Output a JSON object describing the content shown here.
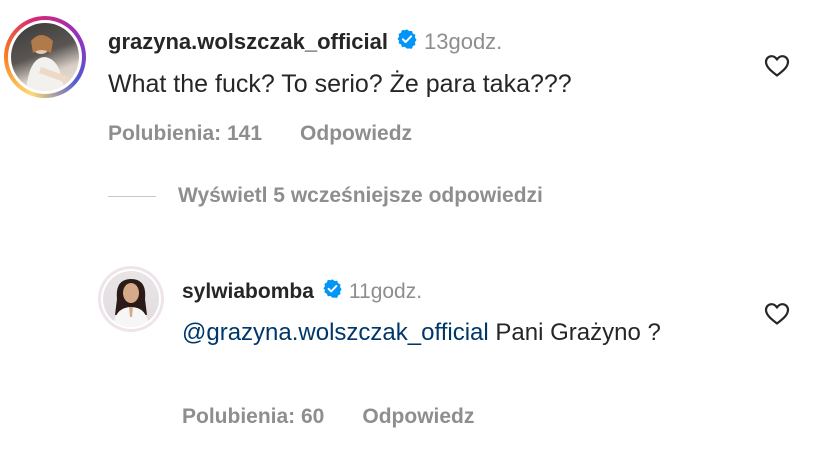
{
  "comments": [
    {
      "username": "grazyna.wolszczak_official",
      "time": "13godz.",
      "text": "What the fuck? To serio? Że para taka???",
      "likes": "Polubienia: 141",
      "reply": "Odpowiedz",
      "avatar_icon": "user-avatar-photo",
      "heart_icon": "heart-outline-icon"
    },
    {
      "username": "sylwiabomba",
      "time": "11godz.",
      "mention": "@grazyna.wolszczak_official",
      "text": "Pani Grażyno ?",
      "likes": "Polubienia: 60",
      "reply": "Odpowiedz",
      "avatar_icon": "user-avatar-photo",
      "heart_icon": "heart-outline-icon"
    }
  ],
  "view_replies": {
    "label": "Wyświetl 5 wcześniejsze odpowiedzi"
  },
  "colors": {
    "text": "#262626",
    "secondary": "#8e8e8e",
    "verified": "#0095f6",
    "mention": "#00376b"
  }
}
